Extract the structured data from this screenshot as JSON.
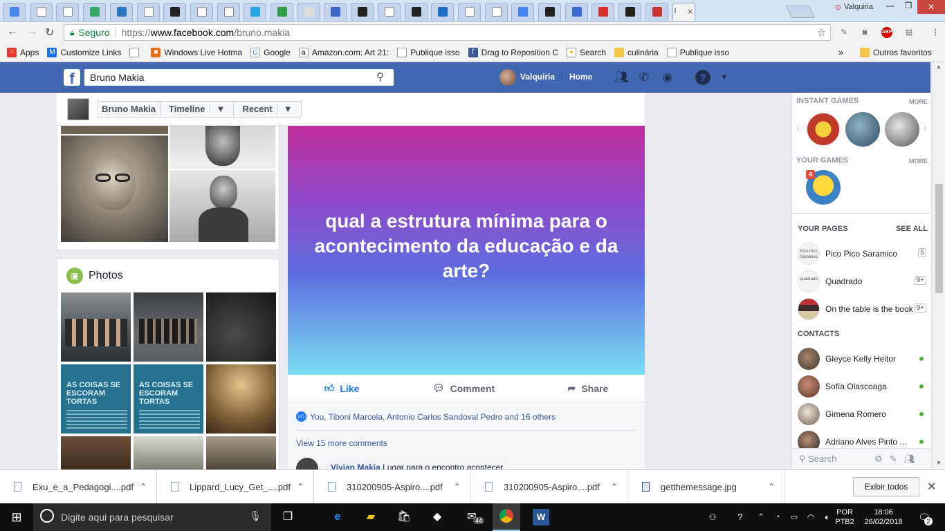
{
  "browser": {
    "user": "Valquiria",
    "secure_label": "Seguro",
    "url_prefix": "https://",
    "url_host": "www.facebook.com",
    "url_path": "/bruno.makia",
    "active_tab_title": "I"
  },
  "bookmarks": [
    {
      "label": "Apps",
      "icon": "apps-grid-icon"
    },
    {
      "label": "Customize Links",
      "icon": "m-icon"
    },
    {
      "label": "",
      "icon": "page-icon"
    },
    {
      "label": "Windows Live Hotma",
      "icon": "windows-icon"
    },
    {
      "label": "Google",
      "icon": "google-icon"
    },
    {
      "label": "Amazon.com: Art 21:",
      "icon": "amazon-icon"
    },
    {
      "label": "Publique isso",
      "icon": "page-icon"
    },
    {
      "label": "Drag to Reposition C",
      "icon": "facebook-icon"
    },
    {
      "label": "Search",
      "icon": "search-bm-icon"
    },
    {
      "label": "culinária",
      "icon": "folder-icon"
    },
    {
      "label": "Publique isso",
      "icon": "page-icon"
    }
  ],
  "bookmarks_more": "»",
  "other_favorites": "Outros favoritos",
  "fb": {
    "search_value": "Bruno Makia",
    "user_name": "Valquiria",
    "home": "Home"
  },
  "subnav": {
    "name": "Bruno Makia",
    "timeline": "Timeline",
    "recent": "Recent"
  },
  "photos_title": "Photos",
  "photo_text": {
    "coisas": "AS COISAS SE ESCORAM TORTAS"
  },
  "post": {
    "question": "qual a estrutura mínima para o acontecimento da educação e da arte?",
    "like": "Like",
    "comment": "Comment",
    "share": "Share",
    "likers": "You, Tiboni Marcela, Antonio Carlos Sandoval Pedro and 16 others",
    "more_comments": "View 15 more comments",
    "comment_author": "Vivian Makia",
    "comment_text": "Lugar para o encontro acontecer"
  },
  "sidebar": {
    "instant_games": "INSTANT GAMES",
    "more": "MORE",
    "your_games": "YOUR GAMES",
    "game_badge": "4",
    "your_pages": "YOUR PAGES",
    "see_all": "SEE ALL",
    "pages": [
      {
        "name": "Pico Pico Saramico",
        "badge": "5",
        "thumb": "Pico Pico Saramico"
      },
      {
        "name": "Quadrado",
        "badge": "9+",
        "thumb": "quadrado"
      },
      {
        "name": "On the table is the book",
        "badge": "9+",
        "thumb": ""
      }
    ],
    "contacts": "CONTACTS",
    "contact_list": [
      {
        "name": "Gleyce Kelly Heitor"
      },
      {
        "name": "Sofía Olascoaga"
      },
      {
        "name": "Gimena Romero"
      },
      {
        "name": "Adriano Alves Pinto ..."
      }
    ],
    "chat_search": "Search"
  },
  "downloads": [
    {
      "name": "Exu_e_a_Pedagogi....pdf"
    },
    {
      "name": "Lippard_Lucy_Get_....pdf"
    },
    {
      "name": "310200905-Aspiro....pdf"
    },
    {
      "name": "310200905-Aspiro....pdf"
    },
    {
      "name": "getthemessage.jpg"
    }
  ],
  "download_show_all": "Exibir todos",
  "taskbar": {
    "search_placeholder": "Digite aqui para pesquisar",
    "mail_badge": "44",
    "lang1": "POR",
    "lang2": "PTB2",
    "time": "18:06",
    "date": "26/02/2018",
    "notif": "2"
  }
}
